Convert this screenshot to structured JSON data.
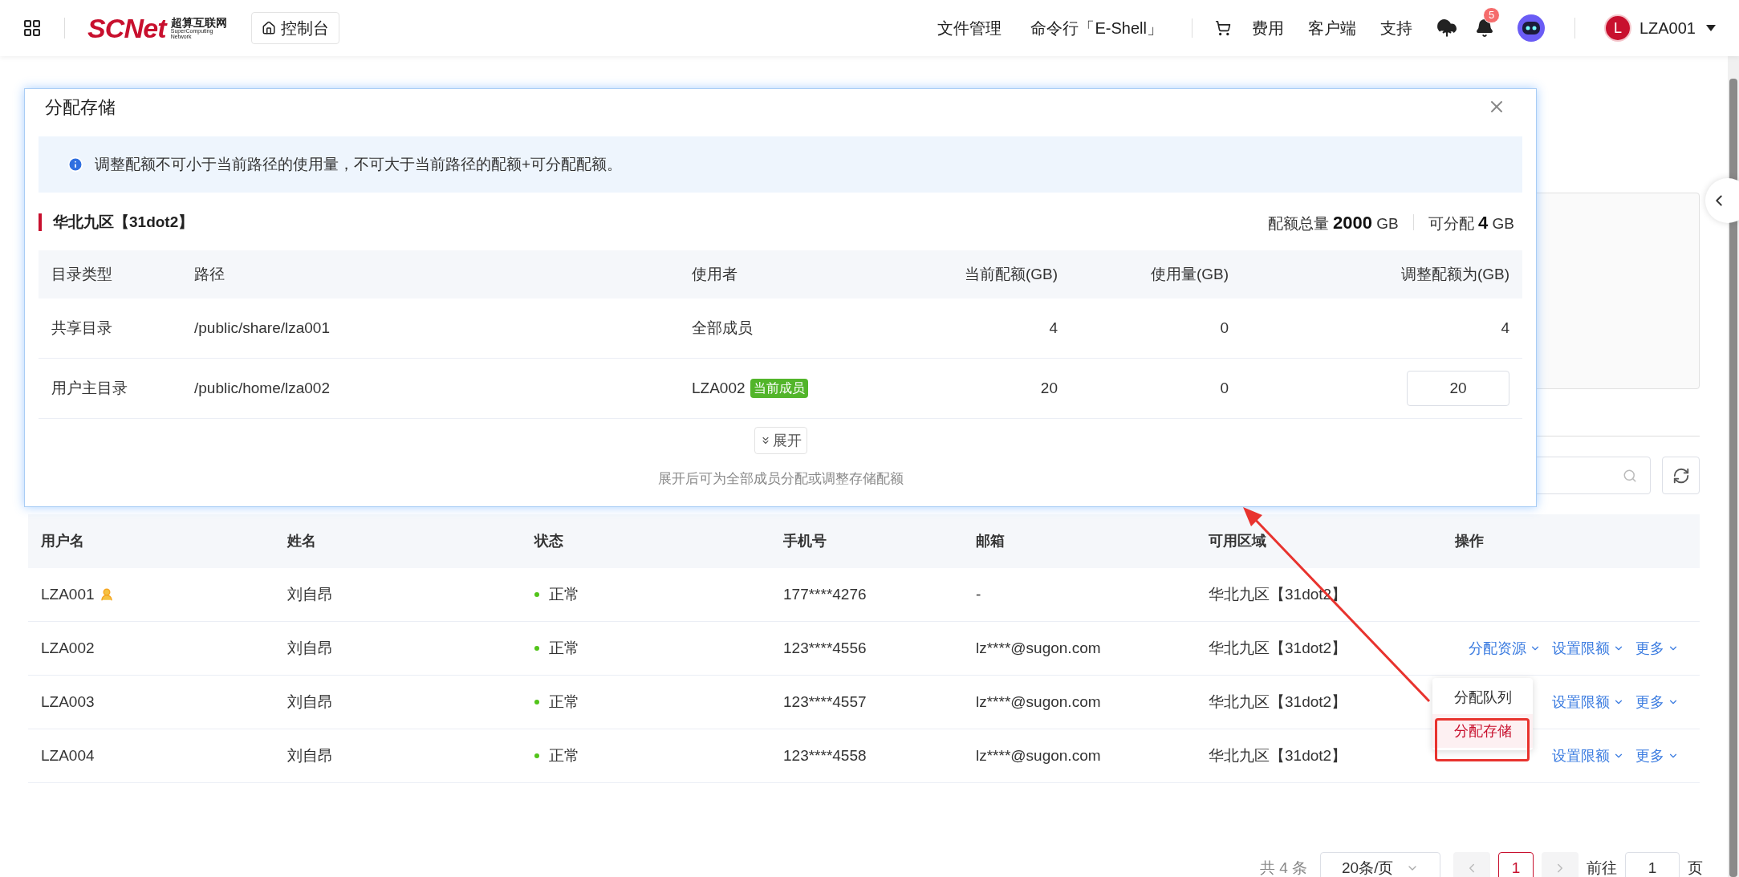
{
  "topbar": {
    "logo": {
      "brand": "SCNet",
      "cn": "超算互联网",
      "en": "SuperComputing Network"
    },
    "console": "控制台",
    "nav": [
      "文件管理",
      "命令行「E-Shell」"
    ],
    "links": [
      "费用",
      "客户端",
      "支持"
    ],
    "notifications": "5",
    "avatar": "L",
    "user": "LZA001"
  },
  "table": {
    "columns": [
      "用户名",
      "姓名",
      "状态",
      "手机号",
      "邮箱",
      "可用区域",
      "操作"
    ],
    "rows": [
      {
        "username": "LZA001",
        "admin": true,
        "name": "刘自昂",
        "status": "正常",
        "phone": "177****4276",
        "email": "-",
        "region": "华北九区【31dot2】",
        "actions": []
      },
      {
        "username": "LZA002",
        "admin": false,
        "name": "刘自昂",
        "status": "正常",
        "phone": "123****4556",
        "email": "lz****@sugon.com",
        "region": "华北九区【31dot2】",
        "actions": [
          "分配资源",
          "设置限额",
          "更多"
        ]
      },
      {
        "username": "LZA003",
        "admin": false,
        "name": "刘自昂",
        "status": "正常",
        "phone": "123****4557",
        "email": "lz****@sugon.com",
        "region": "华北九区【31dot2】",
        "actions": [
          "设置限额",
          "更多"
        ]
      },
      {
        "username": "LZA004",
        "admin": false,
        "name": "刘自昂",
        "status": "正常",
        "phone": "123****4558",
        "email": "lz****@sugon.com",
        "region": "华北九区【31dot2】",
        "actions": [
          "设置限额",
          "更多"
        ]
      }
    ]
  },
  "dropdown": {
    "items": [
      {
        "label": "分配队列",
        "selected": false
      },
      {
        "label": "分配存储",
        "selected": true
      }
    ]
  },
  "pagination": {
    "total": "共 4 条",
    "page_size": "20条/页",
    "page": "1",
    "goto_label": "前往",
    "goto_value": "1",
    "goto_suffix": "页"
  },
  "dialog": {
    "title": "分配存储",
    "info": "调整配额不可小于当前路径的使用量，不可大于当前路径的配额+可分配配额。",
    "region": "华北九区【31dot2】",
    "quota_label": "配额总量",
    "quota_value": "2000",
    "quota_unit": "GB",
    "avail_label": "可分配",
    "avail_value": "4",
    "avail_unit": "GB",
    "columns": [
      "目录类型",
      "路径",
      "使用者",
      "当前配额(GB)",
      "使用量(GB)",
      "调整配额为(GB)"
    ],
    "rows": [
      {
        "type": "共享目录",
        "path": "/public/share/lza001",
        "user": "全部成员",
        "tag": null,
        "quota": "4",
        "used": "0",
        "adjust": "4",
        "editable": false
      },
      {
        "type": "用户主目录",
        "path": "/public/home/lza002",
        "user": "LZA002",
        "tag": "当前成员",
        "quota": "20",
        "used": "0",
        "adjust": "20",
        "editable": true
      }
    ],
    "expand": "展开",
    "hint": "展开后可为全部成员分配或调整存储配额"
  }
}
